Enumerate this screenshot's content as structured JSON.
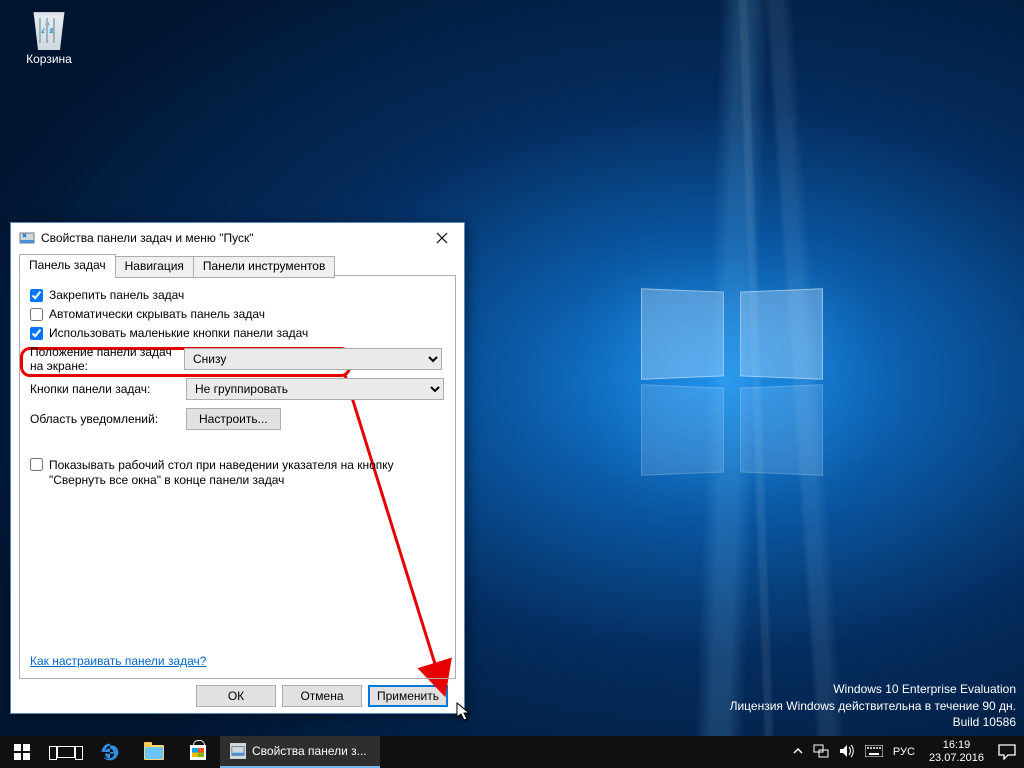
{
  "desktop": {
    "recycle_bin_label": "Корзина"
  },
  "watermark": {
    "line1": "Windows 10 Enterprise Evaluation",
    "line2": "Лицензия Windows действительна в течение 90 дн.",
    "line3": "Build 10586"
  },
  "taskbar": {
    "app_title": "Свойства панели з...",
    "lang": "РУС",
    "time": "16:19",
    "date": "23.07.2016"
  },
  "dialog": {
    "title": "Свойства панели задач и меню \"Пуск\"",
    "tabs": {
      "t0": "Панель задач",
      "t1": "Навигация",
      "t2": "Панели инструментов"
    },
    "chk_lock": "Закрепить панель задач",
    "chk_autohide": "Автоматически скрывать панель задач",
    "chk_smallbtn": "Использовать маленькие кнопки панели задач",
    "lbl_position": "Положение панели задач на экране:",
    "sel_position": "Снизу",
    "lbl_buttons": "Кнопки панели задач:",
    "sel_buttons": "Не группировать",
    "lbl_notif": "Область уведомлений:",
    "btn_notif": "Настроить...",
    "chk_peek": "Показывать рабочий стол при наведении указателя на кнопку \"Свернуть все окна\" в конце панели задач",
    "helplink": "Как настраивать панели задач?",
    "btn_ok": "ОК",
    "btn_cancel": "Отмена",
    "btn_apply": "Применить"
  }
}
